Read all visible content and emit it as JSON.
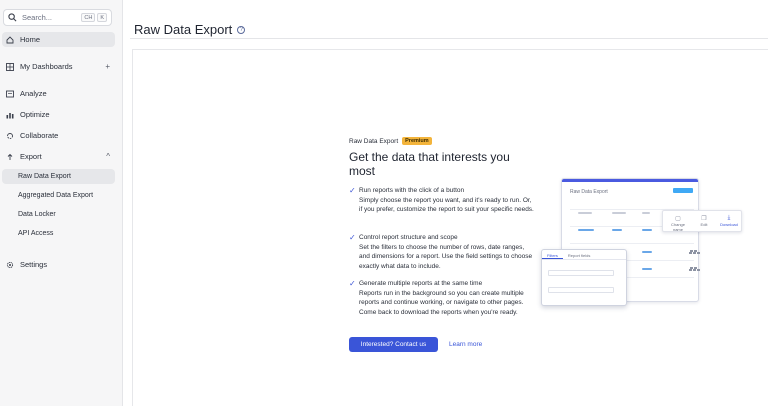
{
  "sidebar": {
    "search": {
      "placeholder": "Search...",
      "shortcut": [
        "CH",
        "K"
      ]
    },
    "items": [
      {
        "label": "Home",
        "icon": "home-icon",
        "active": true
      },
      {
        "label": "My Dashboards",
        "icon": "dashboards-icon",
        "suffix": "+"
      },
      {
        "label": "Analyze",
        "icon": "analyze-icon"
      },
      {
        "label": "Optimize",
        "icon": "optimize-icon"
      },
      {
        "label": "Collaborate",
        "icon": "collaborate-icon"
      },
      {
        "label": "Export",
        "icon": "export-icon",
        "suffix": "^"
      },
      {
        "label": "Settings",
        "icon": "gear-icon"
      }
    ],
    "export_sub": [
      {
        "label": "Raw Data Export",
        "active": true
      },
      {
        "label": "Aggregated Data Export"
      },
      {
        "label": "Data Locker"
      },
      {
        "label": "API Access"
      }
    ]
  },
  "page": {
    "title": "Raw Data Export",
    "help_icon": "help-circle-icon"
  },
  "promo": {
    "eyebrow": "Raw Data Export",
    "badge": "Premium",
    "headline": "Get the data that interests you most",
    "features": [
      {
        "title": "Run reports with the click of a button",
        "body": "Simply choose the report you want, and it's ready to run. Or, if you prefer, customize the report to suit your specific needs."
      },
      {
        "title": "Control report structure and scope",
        "body": "Set the filters to choose the number of rows, date ranges, and dimensions for a report. Use the field settings to choose exactly what data to include."
      },
      {
        "title": "Generate multiple reports at the same time",
        "body": "Reports run in the background so you can create multiple reports and continue working, or navigate to other pages. Come back to download the reports when you're ready."
      }
    ],
    "primary_button": "Interested? Contact us",
    "link": "Learn more"
  },
  "illustration": {
    "window_title": "Raw Data Export",
    "menu": [
      "Change name",
      "Edit",
      "Download"
    ],
    "tabs": [
      "Filters",
      "Report fields"
    ]
  },
  "colors": {
    "accent": "#3a55d8",
    "badge": "#f3b43b",
    "sidebar_bg": "#f6f6f7"
  }
}
